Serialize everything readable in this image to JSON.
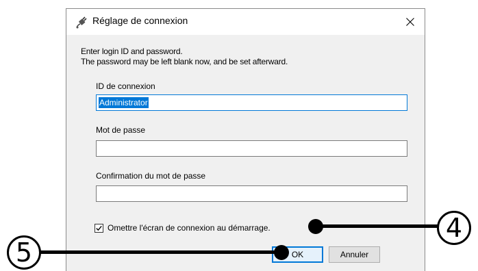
{
  "dialog": {
    "title": "Réglage de connexion",
    "instruction_line1": "Enter login ID and password.",
    "instruction_line2": "The password may be left blank now, and be set afterward.",
    "fields": {
      "login_id_label": "ID de connexion",
      "login_id_value": "Administrator",
      "password_label": "Mot de passe",
      "password_value": "",
      "confirm_label": "Confirmation du mot de passe",
      "confirm_value": ""
    },
    "checkbox": {
      "label": "Omettre l'écran de connexion au démarrage.",
      "checked": true
    },
    "buttons": {
      "ok": "OK",
      "cancel": "Annuler"
    }
  },
  "callouts": {
    "checkbox_marker": "4",
    "ok_marker": "5"
  },
  "colors": {
    "accent": "#0078d7",
    "dialog_bg": "#f0f0f0",
    "titlebar_bg": "#ffffff"
  }
}
